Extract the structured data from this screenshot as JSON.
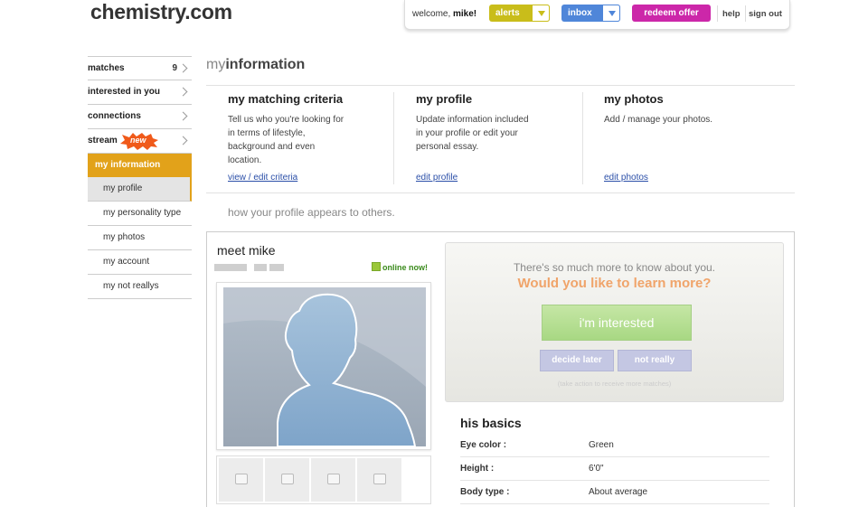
{
  "site": {
    "logo": "chemistry.com"
  },
  "topbar": {
    "welcome_prefix": "welcome, ",
    "username": "mike!",
    "alerts": "alerts",
    "inbox": "inbox",
    "redeem": "redeem offer",
    "help": "help",
    "sign_out": "sign out"
  },
  "sidebar": {
    "items": [
      {
        "label": "matches",
        "count": "9"
      },
      {
        "label": "interested in you",
        "count": ""
      },
      {
        "label": "connections",
        "count": ""
      },
      {
        "label": "stream",
        "count": "",
        "badge": "new"
      }
    ],
    "active": "my information",
    "subitems": [
      "my profile",
      "my personality type",
      "my photos",
      "my account",
      "my not reallys"
    ]
  },
  "main": {
    "title_prefix": "my",
    "title_bold": "information",
    "columns": [
      {
        "title": "my matching criteria",
        "desc": "Tell us who you're looking for in terms of lifestyle, background and even location.",
        "link": "view / edit criteria"
      },
      {
        "title": "my profile",
        "desc": "Update information included in your profile or edit your personal essay.",
        "link": "edit profile"
      },
      {
        "title": "my photos",
        "desc": "Add / manage your photos.",
        "link": "edit photos"
      }
    ],
    "subhead": "how your profile appears to others."
  },
  "profile": {
    "meet": "meet mike",
    "online": "online now!",
    "interest": {
      "line1": "There's so much more to know about you.",
      "line2": "Would you like to learn more?",
      "interested": "i'm interested",
      "decide_later": "decide later",
      "not_really": "not really",
      "fine_print": "(take action to receive more matches)"
    },
    "basics_title": "his basics",
    "basics": [
      {
        "key": "Eye color :",
        "value": "Green"
      },
      {
        "key": "Height :",
        "value": "6'0\""
      },
      {
        "key": "Body type :",
        "value": "About average"
      }
    ]
  },
  "colors": {
    "accent": "#e2a21a",
    "alerts": "#c9bd1a",
    "inbox": "#4f86d9",
    "redeem": "#cc27a9",
    "interested": "#a8d883"
  }
}
